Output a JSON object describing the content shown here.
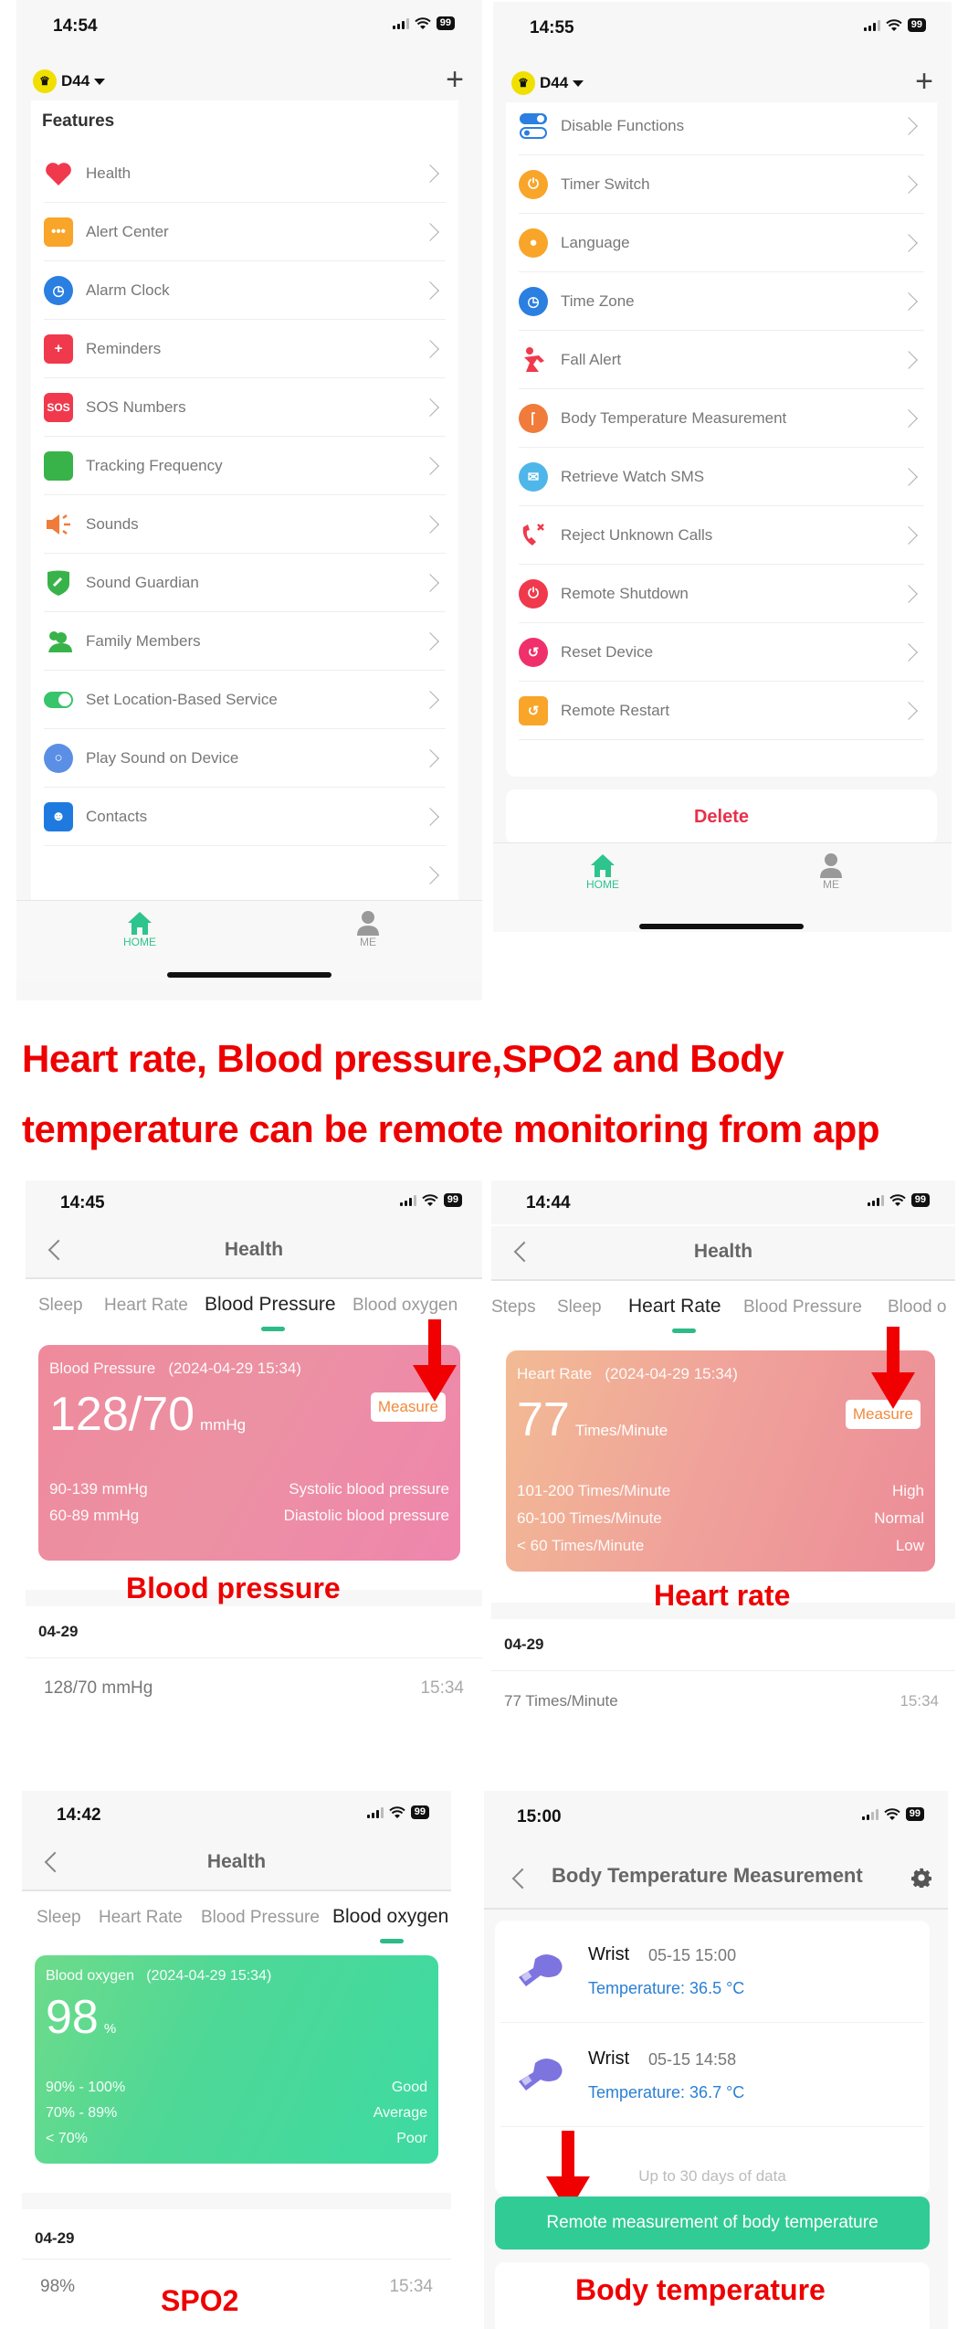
{
  "headline": {
    "line1": "Heart rate, Blood pressure,SPO2 and Body",
    "line2": "temperature can be remote monitoring from app"
  },
  "colors": {
    "accent_green": "#2dc48d",
    "annotation_red": "#ee0000",
    "delete_red": "#e8304a",
    "measure_orange": "#f08a3c",
    "temp_blue": "#2a7fd4"
  },
  "screen1": {
    "status": {
      "time": "14:54",
      "battery": "99"
    },
    "device_name": "D44",
    "add_icon": "plus-icon",
    "section_title": "Features",
    "items": [
      {
        "label": "Health",
        "icon": "heart-icon"
      },
      {
        "label": "Alert Center",
        "icon": "message-icon"
      },
      {
        "label": "Alarm Clock",
        "icon": "alarm-clock-icon"
      },
      {
        "label": "Reminders",
        "icon": "medical-kit-icon"
      },
      {
        "label": "SOS Numbers",
        "icon": "sos-icon",
        "glyph": "SOS"
      },
      {
        "label": "Tracking Frequency",
        "icon": "tracking-icon"
      },
      {
        "label": "Sounds",
        "icon": "speaker-icon"
      },
      {
        "label": "Sound Guardian",
        "icon": "shield-phone-icon"
      },
      {
        "label": "Family Members",
        "icon": "family-icon"
      },
      {
        "label": "Set Location-Based Service",
        "icon": "toggle-icon"
      },
      {
        "label": "Play Sound on Device",
        "icon": "search-sound-icon"
      },
      {
        "label": "Contacts",
        "icon": "contacts-icon"
      },
      {
        "label": "",
        "icon": ""
      }
    ],
    "tabs": [
      {
        "label": "HOME",
        "active": true
      },
      {
        "label": "ME",
        "active": false
      }
    ]
  },
  "screen2": {
    "status": {
      "time": "14:55",
      "battery": "99"
    },
    "device_name": "D44",
    "items": [
      {
        "label": "Disable Functions",
        "icon": "switches-icon"
      },
      {
        "label": "Timer Switch",
        "icon": "timer-power-icon"
      },
      {
        "label": "Language",
        "icon": "globe-icon"
      },
      {
        "label": "Time Zone",
        "icon": "clock-icon"
      },
      {
        "label": "Fall Alert",
        "icon": "fall-person-icon"
      },
      {
        "label": "Body Temperature Measurement",
        "icon": "thermometer-icon"
      },
      {
        "label": "Retrieve Watch SMS",
        "icon": "envelope-icon"
      },
      {
        "label": "Reject Unknown Calls",
        "icon": "phone-reject-icon"
      },
      {
        "label": "Remote Shutdown",
        "icon": "power-icon"
      },
      {
        "label": "Reset Device",
        "icon": "reset-icon"
      },
      {
        "label": "Remote Restart",
        "icon": "watch-restart-icon"
      }
    ],
    "delete_label": "Delete",
    "tabs": [
      {
        "label": "HOME",
        "active": true
      },
      {
        "label": "ME",
        "active": false
      }
    ]
  },
  "blood_pressure": {
    "status": {
      "time": "14:45",
      "battery": "99"
    },
    "title": "Health",
    "tabs": [
      "Sleep",
      "Heart Rate",
      "Blood Pressure",
      "Blood oxygen"
    ],
    "selected_tab": "Blood Pressure",
    "card_caption": "Blood Pressure   (2024-04-29 15:34)",
    "value": "128/70",
    "unit": "mmHg",
    "measure_label": "Measure",
    "ranges": [
      {
        "range": "90-139 mmHg",
        "label": "Systolic blood pressure"
      },
      {
        "range": "60-89 mmHg",
        "label": "Diastolic blood pressure"
      }
    ],
    "annotation": "Blood pressure",
    "history_date": "04-29",
    "history": [
      {
        "value": "128/70 mmHg",
        "time": "15:34"
      }
    ]
  },
  "heart_rate": {
    "status": {
      "time": "14:44",
      "battery": "99"
    },
    "title": "Health",
    "tabs": [
      "Steps",
      "Sleep",
      "Heart Rate",
      "Blood Pressure",
      "Blood o"
    ],
    "selected_tab": "Heart Rate",
    "card_caption": "Heart Rate   (2024-04-29 15:34)",
    "value": "77",
    "unit": "Times/Minute",
    "measure_label": "Measure",
    "ranges": [
      {
        "range": "101-200 Times/Minute",
        "label": "High"
      },
      {
        "range": "60-100 Times/Minute",
        "label": "Normal"
      },
      {
        "range": "< 60 Times/Minute",
        "label": "Low"
      }
    ],
    "annotation": "Heart rate",
    "history_date": "04-29",
    "history": [
      {
        "value": "77 Times/Minute",
        "time": "15:34"
      }
    ]
  },
  "spo2": {
    "status": {
      "time": "14:42",
      "battery": "99"
    },
    "title": "Health",
    "tabs": [
      "Sleep",
      "Heart Rate",
      "Blood Pressure",
      "Blood oxygen"
    ],
    "selected_tab": "Blood oxygen",
    "card_caption": "Blood oxygen   (2024-04-29 15:34)",
    "value": "98",
    "unit": "%",
    "ranges": [
      {
        "range": "90% - 100%",
        "label": "Good"
      },
      {
        "range": "70% - 89%",
        "label": "Average"
      },
      {
        "range": "< 70%",
        "label": "Poor"
      }
    ],
    "annotation": "SPO2",
    "history_date": "04-29",
    "history": [
      {
        "value": "98%",
        "time": "15:34"
      }
    ]
  },
  "body_temp": {
    "status": {
      "time": "15:00",
      "battery": "99"
    },
    "title": "Body Temperature Measurement",
    "records": [
      {
        "location": "Wrist",
        "datetime": "05-15 15:00",
        "temperature": "Temperature: 36.5 °C"
      },
      {
        "location": "Wrist",
        "datetime": "05-15 14:58",
        "temperature": "Temperature: 36.7 °C"
      }
    ],
    "footer_note": "Up to 30 days of data",
    "button_label": "Remote measurement of body temperature",
    "annotation": "Body temperature"
  }
}
